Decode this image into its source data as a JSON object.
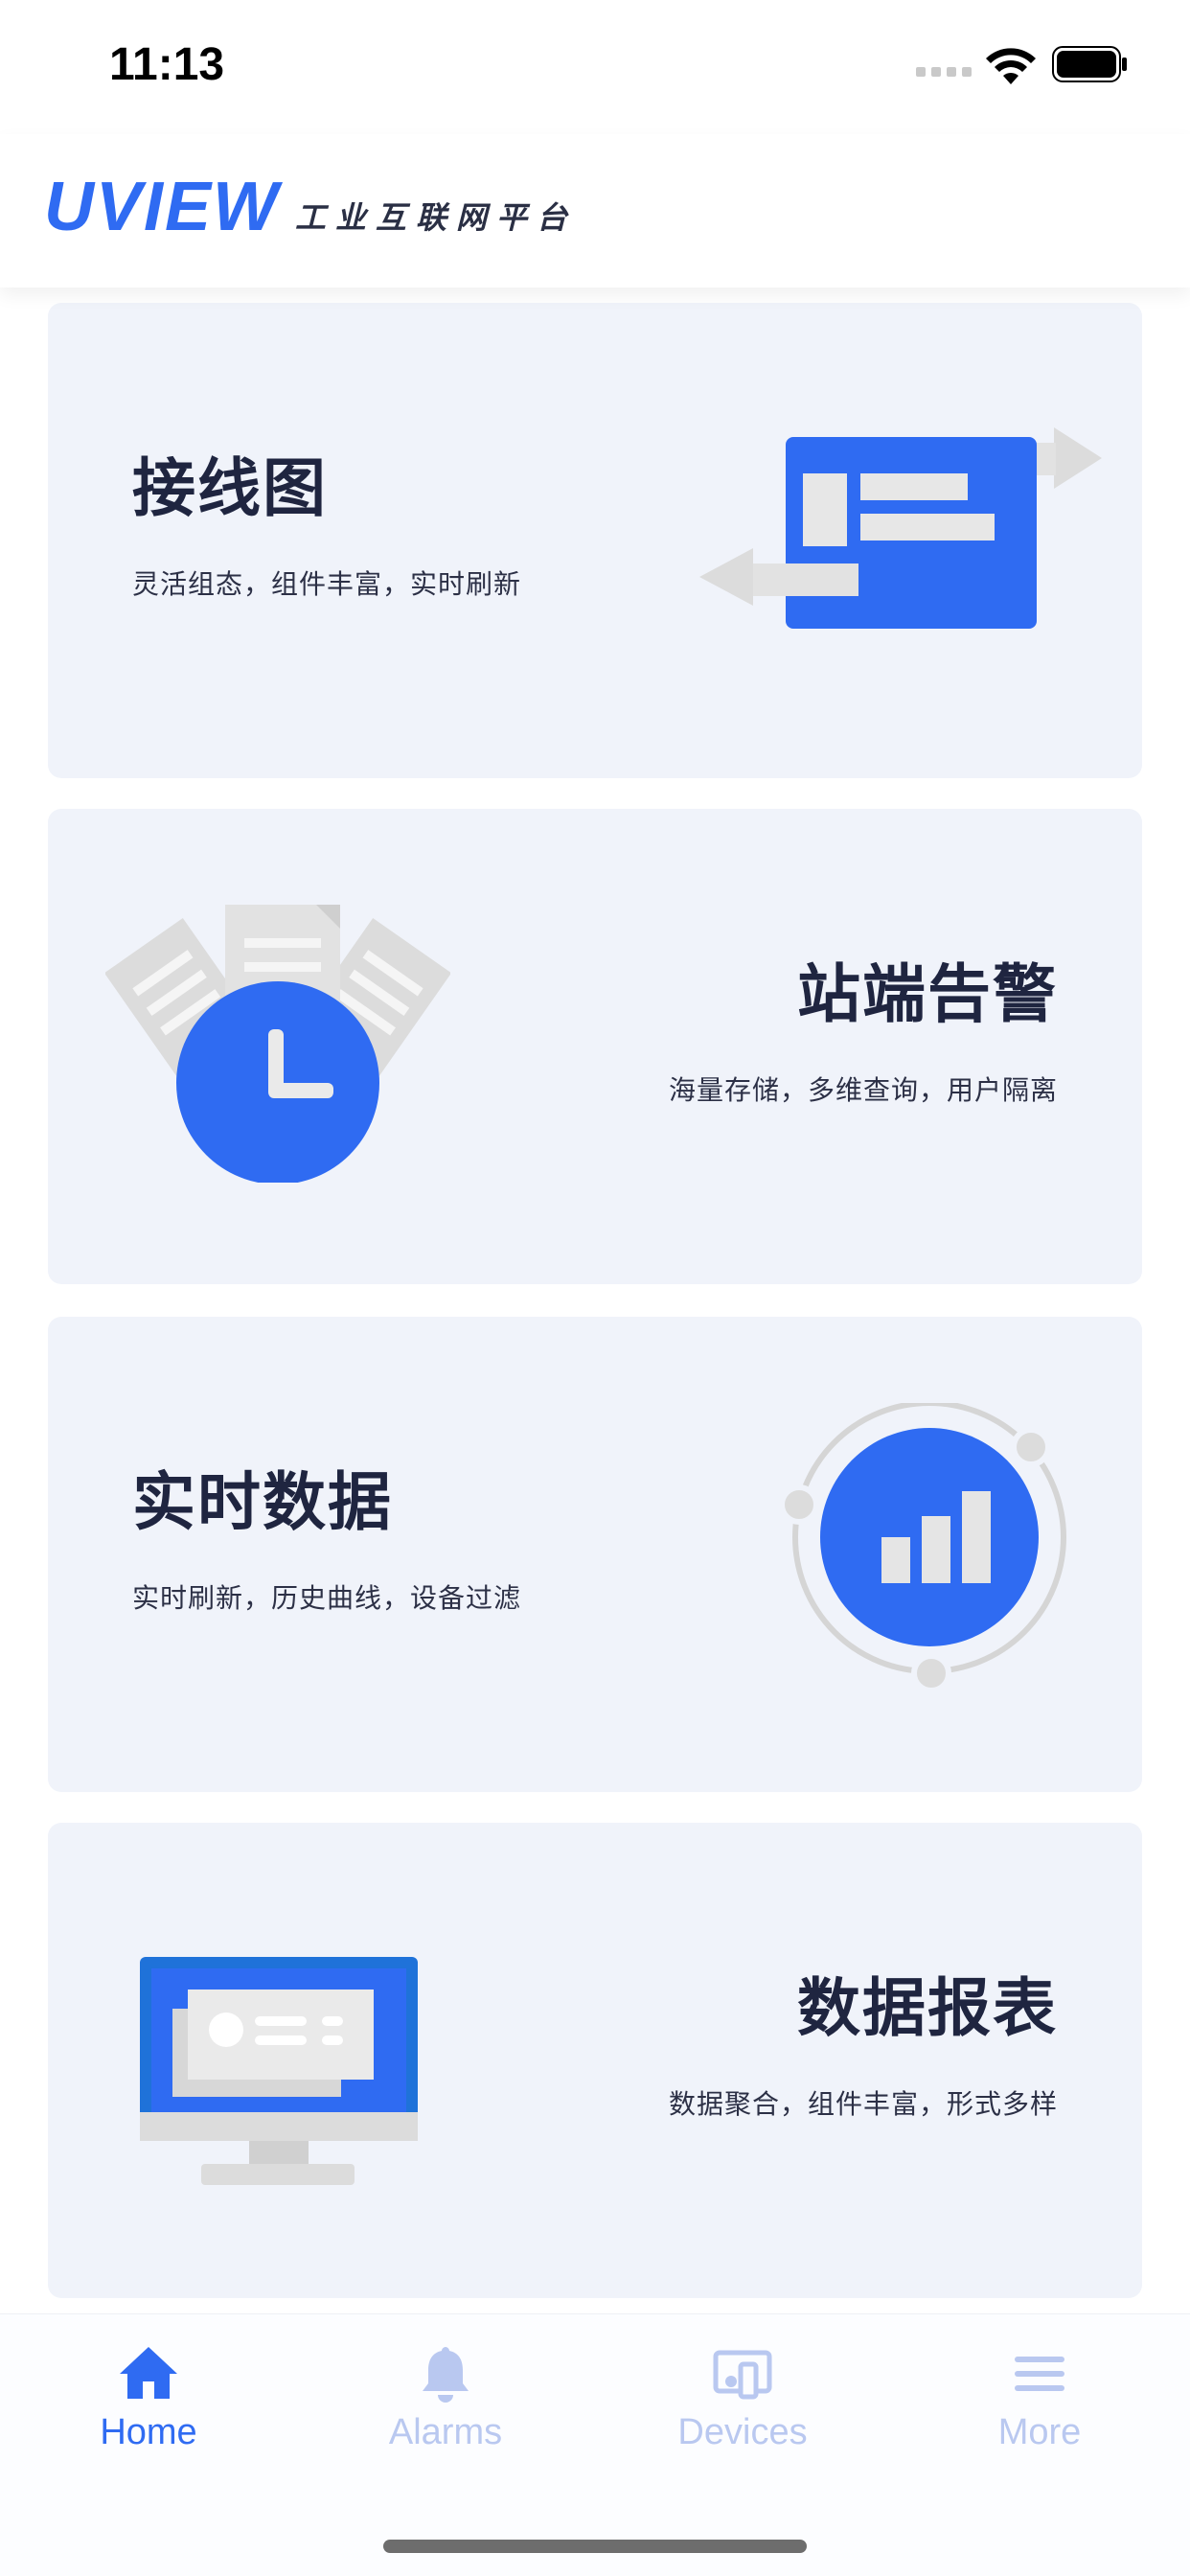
{
  "status_bar": {
    "time": "11:13"
  },
  "header": {
    "logo": "UVIEW",
    "tagline": "工业互联网平台"
  },
  "cards": [
    {
      "title": "接线图",
      "subtitle": "灵活组态，组件丰富，实时刷新",
      "icon": "wiring-diagram-icon"
    },
    {
      "title": "站端告警",
      "subtitle": "海量存储，多维查询，用户隔离",
      "icon": "alarm-clock-icon"
    },
    {
      "title": "实时数据",
      "subtitle": "实时刷新，历史曲线，设备过滤",
      "icon": "bar-chart-icon"
    },
    {
      "title": "数据报表",
      "subtitle": "数据聚合，组件丰富，形式多样",
      "icon": "monitor-report-icon"
    }
  ],
  "tab_bar": {
    "tabs": [
      {
        "label": "Home",
        "icon": "home-icon",
        "active": true
      },
      {
        "label": "Alarms",
        "icon": "bell-icon",
        "active": false
      },
      {
        "label": "Devices",
        "icon": "devices-icon",
        "active": false
      },
      {
        "label": "More",
        "icon": "menu-icon",
        "active": false
      }
    ]
  },
  "colors": {
    "accent": "#2f6bf2",
    "card_bg": "#f0f3fa",
    "title": "#1f2540",
    "inactive_tab": "#b9c8f0"
  }
}
